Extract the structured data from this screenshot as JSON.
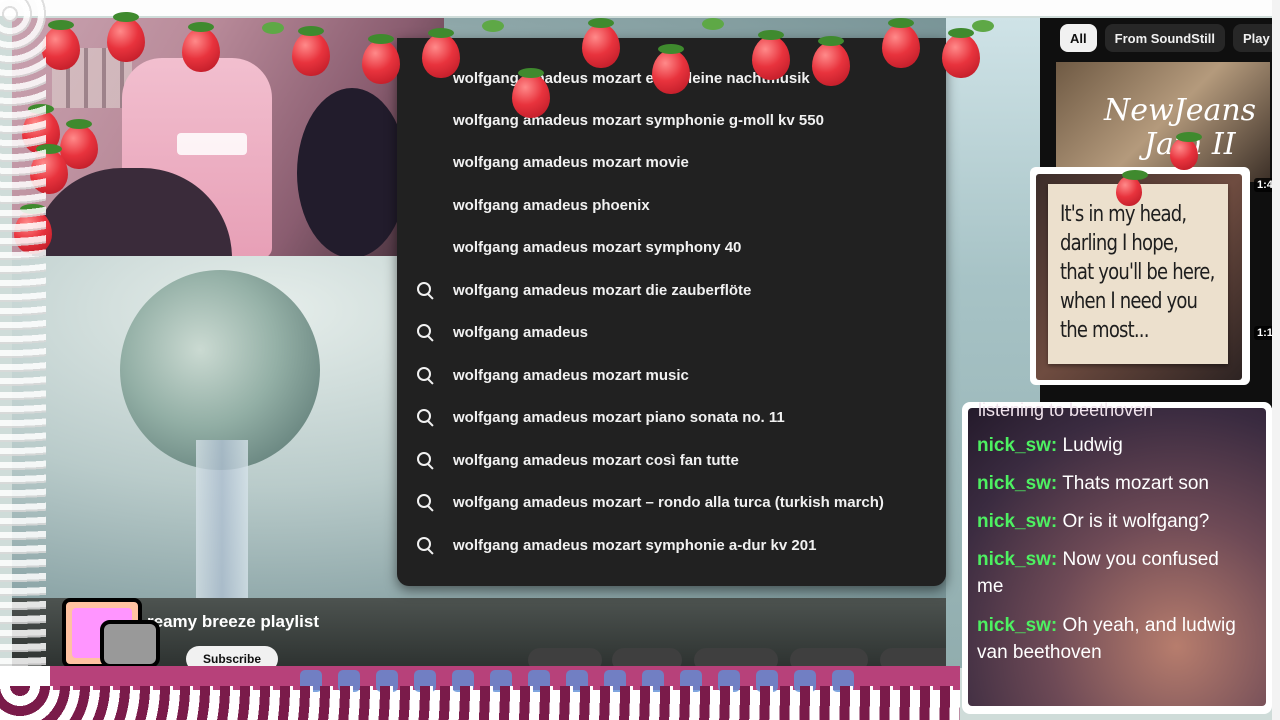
{
  "search": {
    "suggestions": [
      "wolfgang amadeus mozart eine kleine nachtmusik",
      "wolfgang amadeus mozart symphonie g-moll kv 550",
      "wolfgang amadeus mozart movie",
      "wolfgang amadeus phoenix",
      "wolfgang amadeus mozart symphony 40",
      "wolfgang amadeus mozart die zauberflöte",
      "wolfgang amadeus",
      "wolfgang amadeus mozart music",
      "wolfgang amadeus mozart piano sonata no. 11",
      "wolfgang amadeus mozart così fan tutte",
      "wolfgang amadeus mozart – rondo alla turca (turkish march)",
      "wolfgang amadeus mozart symphonie a-dur kv 201"
    ]
  },
  "video": {
    "title": "reamy breeze playlist",
    "subscribe_label": "Subscribe"
  },
  "related": {
    "chips": [
      "All",
      "From SoundStill",
      "Play"
    ],
    "thumb1_title_line1": "NewJeans",
    "thumb1_title_line2": "Jam II",
    "thumb1_duration": "1:4",
    "thumb2_duration": "1:1"
  },
  "overlay": {
    "quote_lines": [
      "It's in my head,",
      "darling I hope,",
      "that you'll be here,",
      "when I need you",
      "the most..."
    ],
    "chat_header": "listening to beethoven",
    "chat": [
      {
        "user": "nick_sw:",
        "text": "Ludwig"
      },
      {
        "user": "nick_sw:",
        "text": "Thats mozart son"
      },
      {
        "user": "nick_sw:",
        "text": "Or is it wolfgang?"
      },
      {
        "user": "nick_sw:",
        "text": "Now you confused me"
      },
      {
        "user": "nick_sw:",
        "text": "Oh yeah, and ludwig van beethoven"
      }
    ]
  },
  "colors": {
    "dropdown_bg": "#212121",
    "chat_username": "#4df061",
    "lace_band": "#b7417a"
  }
}
